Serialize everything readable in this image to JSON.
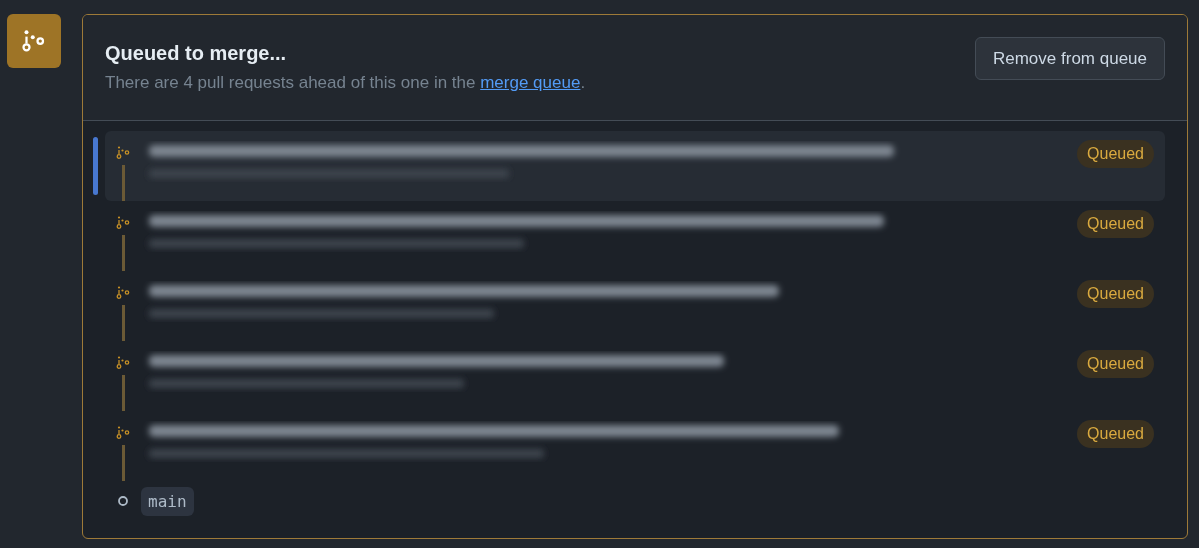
{
  "status_icon": {
    "kind": "merge-queue"
  },
  "header": {
    "title": "Queued to merge...",
    "description_before": "There are 4 pull requests ahead of this one in the ",
    "link": "merge queue",
    "description_after": ".",
    "button": "Remove from queue"
  },
  "queue": [
    {
      "selected": true,
      "status": "Queued"
    },
    {
      "selected": false,
      "status": "Queued"
    },
    {
      "selected": false,
      "status": "Queued"
    },
    {
      "selected": false,
      "status": "Queued"
    },
    {
      "selected": false,
      "status": "Queued"
    }
  ],
  "base_branch": "main"
}
